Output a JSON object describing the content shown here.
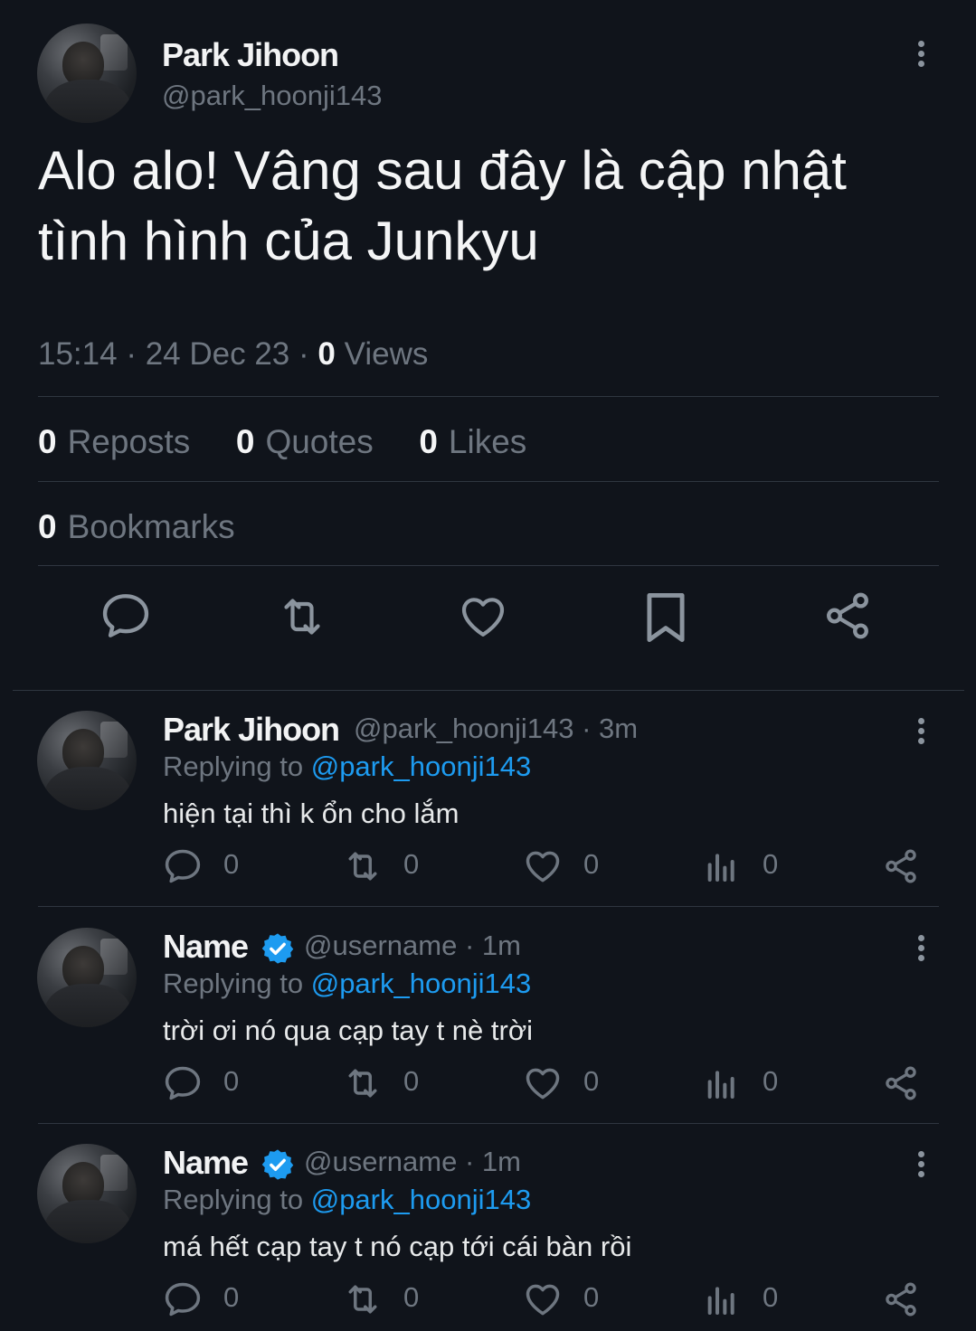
{
  "main": {
    "author": {
      "name": "Park Jihoon",
      "handle": "@park_hoonji143"
    },
    "text": "Alo alo! Vâng sau đây là cập nhật tình hình của Junkyu",
    "time": "15:14",
    "date": "24 Dec 23",
    "views_count": "0",
    "views_label": "Views",
    "reposts_count": "0",
    "reposts_label": "Reposts",
    "quotes_count": "0",
    "quotes_label": "Quotes",
    "likes_count": "0",
    "likes_label": "Likes",
    "bookmarks_count": "0",
    "bookmarks_label": "Bookmarks",
    "separator": "·"
  },
  "replies": [
    {
      "name": "Park Jihoon",
      "handle": "@park_hoonji143",
      "time": "· 3m",
      "verified": false,
      "replying_label": "Replying to",
      "replying_to": "@park_hoonji143",
      "text": "hiện tại thì k ổn cho lắm",
      "replies": "0",
      "reposts": "0",
      "likes": "0",
      "views": "0"
    },
    {
      "name": "Name",
      "handle": "@username",
      "time": "· 1m",
      "verified": true,
      "replying_label": "Replying to",
      "replying_to": "@park_hoonji143",
      "text": "trời ơi nó qua cạp tay t nè trời",
      "replies": "0",
      "reposts": "0",
      "likes": "0",
      "views": "0"
    },
    {
      "name": "Name",
      "handle": "@username",
      "time": "· 1m",
      "verified": true,
      "replying_label": "Replying to",
      "replying_to": "@park_hoonji143",
      "text": "má hết cạp tay t nó cạp tới cái bàn rồi",
      "replies": "0",
      "reposts": "0",
      "likes": "0",
      "views": "0"
    }
  ],
  "colors": {
    "background": "#10141b",
    "accent": "#1d9bf0",
    "muted": "#6e7680"
  }
}
